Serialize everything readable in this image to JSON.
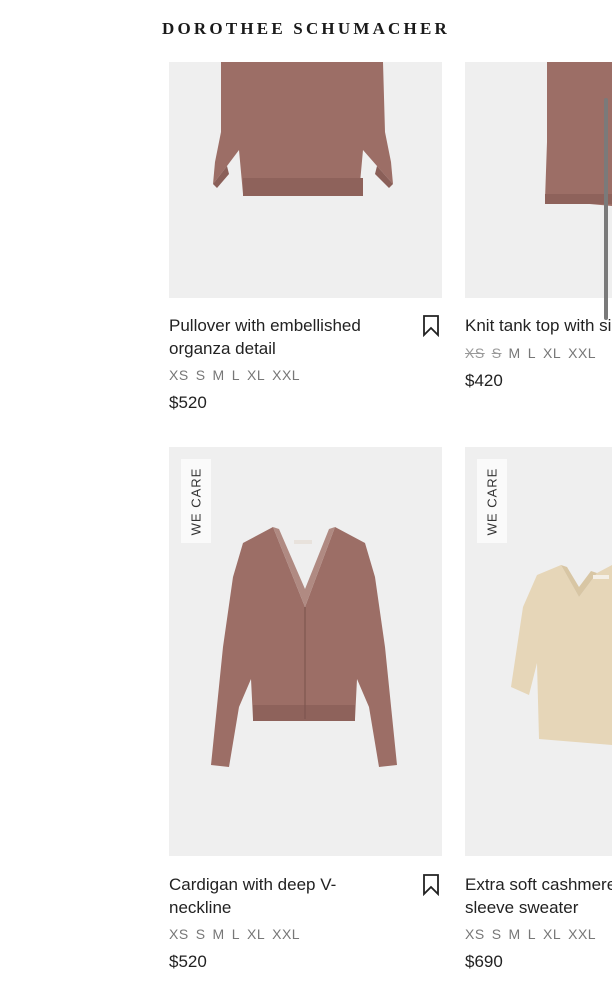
{
  "header": {
    "brand": "DOROTHEE SCHUMACHER"
  },
  "products": [
    {
      "title": "Pullover with embellished organza detail",
      "sizes": [
        {
          "label": "XS",
          "available": true
        },
        {
          "label": "S",
          "available": true
        },
        {
          "label": "M",
          "available": true
        },
        {
          "label": "L",
          "available": true
        },
        {
          "label": "XL",
          "available": true
        },
        {
          "label": "XXL",
          "available": true
        }
      ],
      "price": "$520",
      "badge": ""
    },
    {
      "title": "Knit tank top with si",
      "sizes": [
        {
          "label": "XS",
          "available": false
        },
        {
          "label": "S",
          "available": false
        },
        {
          "label": "M",
          "available": true
        },
        {
          "label": "L",
          "available": true
        },
        {
          "label": "XL",
          "available": true
        },
        {
          "label": "XXL",
          "available": true
        }
      ],
      "price": "$420",
      "badge": ""
    },
    {
      "title": "Cardigan with deep V-neckline",
      "sizes": [
        {
          "label": "XS",
          "available": true
        },
        {
          "label": "S",
          "available": true
        },
        {
          "label": "M",
          "available": true
        },
        {
          "label": "L",
          "available": true
        },
        {
          "label": "XL",
          "available": true
        },
        {
          "label": "XXL",
          "available": true
        }
      ],
      "price": "$520",
      "badge": "WE CARE"
    },
    {
      "title": "Extra soft cashmere sleeve sweater",
      "sizes": [
        {
          "label": "XS",
          "available": true
        },
        {
          "label": "S",
          "available": true
        },
        {
          "label": "M",
          "available": true
        },
        {
          "label": "L",
          "available": true
        },
        {
          "label": "XL",
          "available": true
        },
        {
          "label": "XXL",
          "available": true
        }
      ],
      "price": "$690",
      "badge": "WE CARE"
    }
  ],
  "colors": {
    "mauve": "#9c6e66",
    "cream": "#e6d6b8",
    "image_bg": "#efefef"
  },
  "icons": {
    "bookmark": "bookmark-icon"
  }
}
